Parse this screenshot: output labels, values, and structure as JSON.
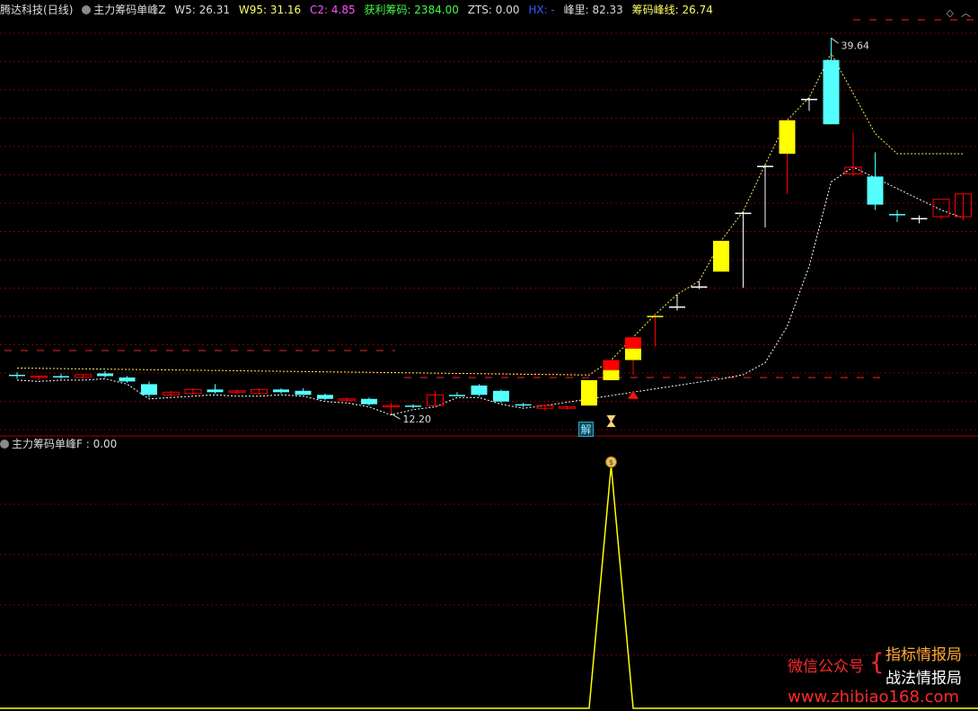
{
  "header": {
    "stock": "腾达科技",
    "period": "(日线)",
    "indicator": "主力筹码单峰Z",
    "w5": "W5: 26.31",
    "w95": "W95: 31.16",
    "c2": "C2: 4.85",
    "profit": "获利筹码: 2384.00",
    "zts": "ZTS: 0.00",
    "hx": "HX: -",
    "peak_label": "峰里: 82.33",
    "peak_line": "筹码峰线: 26.74"
  },
  "sub_header": {
    "indicator": "主力筹码单峰F : 0.00"
  },
  "annotations": {
    "high": "39.64",
    "low": "12.20",
    "signal": "解"
  },
  "watermark": {
    "wechat": "微信公众号",
    "brace": "{",
    "line1": "指标情报局",
    "line2": "战法情报局",
    "url": "www.zhibiao168.com"
  },
  "colors": {
    "background": "#000000",
    "up_yellow": "#ffff00",
    "up_red": "#ff0000",
    "down_cyan": "#54ffff",
    "grid_red": "#7a0000",
    "white": "#ffffff"
  },
  "chart_data": {
    "type": "candlestick",
    "price_range": [
      10.0,
      41.0
    ],
    "candles": [
      {
        "o": 14.5,
        "h": 14.7,
        "l": 14.2,
        "c": 14.4,
        "color": "cyan"
      },
      {
        "o": 14.3,
        "h": 14.4,
        "l": 14.1,
        "c": 14.4,
        "color": "red_hollow"
      },
      {
        "o": 14.4,
        "h": 14.6,
        "l": 14.2,
        "c": 14.3,
        "color": "cyan"
      },
      {
        "o": 14.3,
        "h": 14.5,
        "l": 14.2,
        "c": 14.5,
        "color": "red_hollow"
      },
      {
        "o": 14.6,
        "h": 14.8,
        "l": 14.3,
        "c": 14.4,
        "color": "cyan"
      },
      {
        "o": 14.3,
        "h": 14.4,
        "l": 13.9,
        "c": 14.0,
        "color": "cyan"
      },
      {
        "o": 13.8,
        "h": 14.0,
        "l": 12.8,
        "c": 13.0,
        "color": "cyan"
      },
      {
        "o": 13.0,
        "h": 13.3,
        "l": 12.9,
        "c": 13.2,
        "color": "red_hollow"
      },
      {
        "o": 13.1,
        "h": 13.5,
        "l": 13.0,
        "c": 13.4,
        "color": "red_hollow"
      },
      {
        "o": 13.4,
        "h": 13.8,
        "l": 13.1,
        "c": 13.2,
        "color": "cyan"
      },
      {
        "o": 13.2,
        "h": 13.4,
        "l": 13.0,
        "c": 13.3,
        "color": "red_hollow"
      },
      {
        "o": 13.1,
        "h": 13.5,
        "l": 13.0,
        "c": 13.4,
        "color": "red_hollow"
      },
      {
        "o": 13.4,
        "h": 13.5,
        "l": 13.1,
        "c": 13.2,
        "color": "cyan"
      },
      {
        "o": 13.3,
        "h": 13.5,
        "l": 13.0,
        "c": 13.0,
        "color": "cyan"
      },
      {
        "o": 13.0,
        "h": 13.1,
        "l": 12.6,
        "c": 12.7,
        "color": "cyan"
      },
      {
        "o": 12.7,
        "h": 12.8,
        "l": 12.5,
        "c": 12.7,
        "color": "red_hollow"
      },
      {
        "o": 12.7,
        "h": 12.8,
        "l": 12.2,
        "c": 12.3,
        "color": "cyan"
      },
      {
        "o": 12.2,
        "h": 12.4,
        "l": 11.6,
        "c": 12.2,
        "color": "red_hollow"
      },
      {
        "o": 12.2,
        "h": 12.3,
        "l": 12.0,
        "c": 12.2,
        "color": "cyan"
      },
      {
        "o": 12.2,
        "h": 13.3,
        "l": 12.2,
        "c": 13.0,
        "color": "red_hollow"
      },
      {
        "o": 13.0,
        "h": 13.2,
        "l": 12.9,
        "c": 13.0,
        "color": "cyan"
      },
      {
        "o": 13.0,
        "h": 13.8,
        "l": 12.9,
        "c": 13.7,
        "color": "cyan"
      },
      {
        "o": 13.3,
        "h": 13.4,
        "l": 12.4,
        "c": 12.5,
        "color": "cyan"
      },
      {
        "o": 12.3,
        "h": 12.4,
        "l": 12.1,
        "c": 12.2,
        "color": "cyan"
      },
      {
        "o": 12.2,
        "h": 12.3,
        "l": 11.8,
        "c": 12.0,
        "color": "red_hollow"
      },
      {
        "o": 12.0,
        "h": 12.2,
        "l": 11.9,
        "c": 12.1,
        "color": "red_hollow"
      },
      {
        "o": 12.2,
        "h": 14.1,
        "l": 12.2,
        "c": 14.1,
        "color": "yellow"
      },
      {
        "o": 14.1,
        "h": 15.6,
        "l": 14.1,
        "c": 15.6,
        "color": "split"
      },
      {
        "o": 15.6,
        "h": 17.3,
        "l": 14.5,
        "c": 17.3,
        "color": "split"
      },
      {
        "o": 18.9,
        "h": 19.0,
        "l": 16.6,
        "c": 18.9,
        "color": "yellow"
      },
      {
        "o": 19.5,
        "h": 20.5,
        "l": 19.3,
        "c": 19.6,
        "color": "white"
      },
      {
        "o": 21.0,
        "h": 21.5,
        "l": 20.9,
        "c": 21.1,
        "color": "white"
      },
      {
        "o": 22.2,
        "h": 24.5,
        "l": 22.2,
        "c": 24.5,
        "color": "yellow"
      },
      {
        "o": 26.5,
        "h": 26.7,
        "l": 21.0,
        "c": 26.6,
        "color": "white"
      },
      {
        "o": 30.0,
        "h": 30.2,
        "l": 25.5,
        "c": 30.1,
        "color": "white"
      },
      {
        "o": 31.0,
        "h": 33.5,
        "l": 28.0,
        "c": 33.5,
        "color": "yellow"
      },
      {
        "o": 35.0,
        "h": 35.2,
        "l": 34.2,
        "c": 35.1,
        "color": "white"
      },
      {
        "o": 38.0,
        "h": 39.64,
        "l": 33.2,
        "c": 33.2,
        "color": "cyan"
      },
      {
        "o": 29.5,
        "h": 32.6,
        "l": 29.3,
        "c": 30.0,
        "color": "red_hollow"
      },
      {
        "o": 29.3,
        "h": 31.1,
        "l": 26.8,
        "c": 27.2,
        "color": "cyan"
      },
      {
        "o": 26.5,
        "h": 26.8,
        "l": 25.9,
        "c": 26.4,
        "color": "cyan"
      },
      {
        "o": 26.2,
        "h": 26.4,
        "l": 25.8,
        "c": 26.2,
        "color": "white"
      },
      {
        "o": 26.3,
        "h": 26.4,
        "l": 26.1,
        "c": 27.6,
        "color": "red_hollow"
      },
      {
        "o": 26.3,
        "h": 28.0,
        "l": 26.0,
        "c": 28.0,
        "color": "red_hollow"
      }
    ],
    "f_values": [
      0,
      0,
      0,
      0,
      0,
      0,
      0,
      0,
      0,
      0,
      0,
      0,
      0,
      0,
      0,
      0,
      0,
      0,
      0,
      0,
      0,
      0,
      0,
      0,
      0,
      0,
      0,
      1,
      0,
      0,
      0,
      0,
      0,
      0,
      0,
      0,
      0,
      0,
      0,
      0,
      0,
      0,
      0,
      0
    ]
  }
}
